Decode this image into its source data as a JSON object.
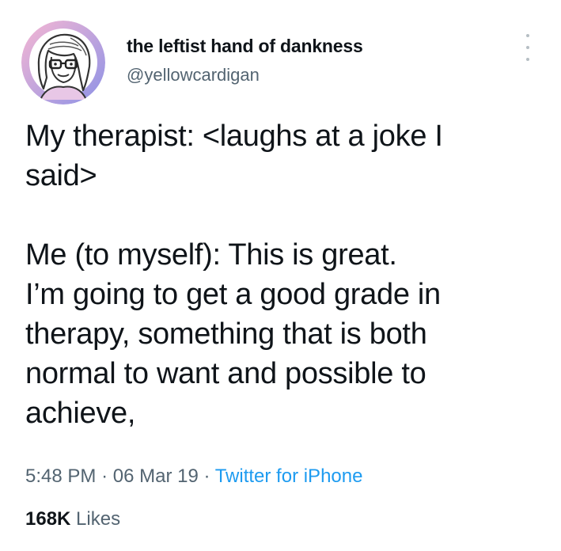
{
  "tweet": {
    "author": {
      "display_name": "the leftist hand of dankness",
      "handle": "@yellowcardigan",
      "avatar": "cartoon-avatar-glasses"
    },
    "text_paragraphs": [
      "My therapist: <laughs at a joke I\nsaid>",
      "Me (to myself): This is great.\nI’m going to get a good grade in\ntherapy, something that is both\nnormal to want and possible to\nachieve,"
    ],
    "time": "5:48 PM",
    "separator": "·",
    "date": "06 Mar 19",
    "source": "Twitter for iPhone",
    "likes_count": "168K",
    "likes_label": "Likes"
  },
  "icons": {
    "more": "more-vertical-icon"
  },
  "colors": {
    "text_primary": "#0f1419",
    "text_secondary": "#536471",
    "link": "#1d9bf0",
    "avatar_ring_start": "#f0a3c8",
    "avatar_ring_end": "#8e96e8"
  }
}
